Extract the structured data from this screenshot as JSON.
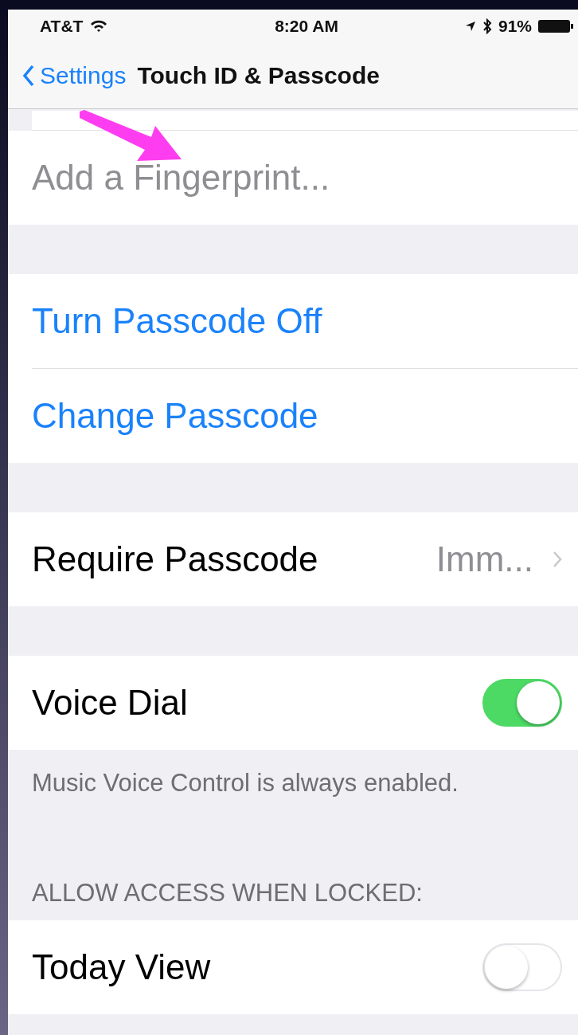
{
  "status_bar": {
    "carrier": "AT&T",
    "time": "8:20 AM",
    "battery": "91%"
  },
  "nav_bar": {
    "back_label": "Settings",
    "title": "Touch ID & Passcode"
  },
  "groups": [
    {
      "rows": [
        {
          "kind": "action",
          "label": "Add a Fingerprint...",
          "disabled": true
        }
      ]
    },
    {
      "rows": [
        {
          "kind": "action",
          "label": "Turn Passcode Off",
          "disabled": false
        },
        {
          "kind": "action",
          "label": "Change Passcode",
          "disabled": false
        }
      ]
    },
    {
      "rows": [
        {
          "kind": "detail",
          "label": "Require Passcode",
          "value": "Imm..."
        }
      ]
    },
    {
      "rows": [
        {
          "kind": "toggle",
          "label": "Voice Dial",
          "on": true
        }
      ],
      "footer": "Music Voice Control is always enabled."
    },
    {
      "header": "ALLOW ACCESS WHEN LOCKED:",
      "rows": [
        {
          "kind": "toggle",
          "label": "Today View",
          "on": false
        }
      ]
    }
  ]
}
